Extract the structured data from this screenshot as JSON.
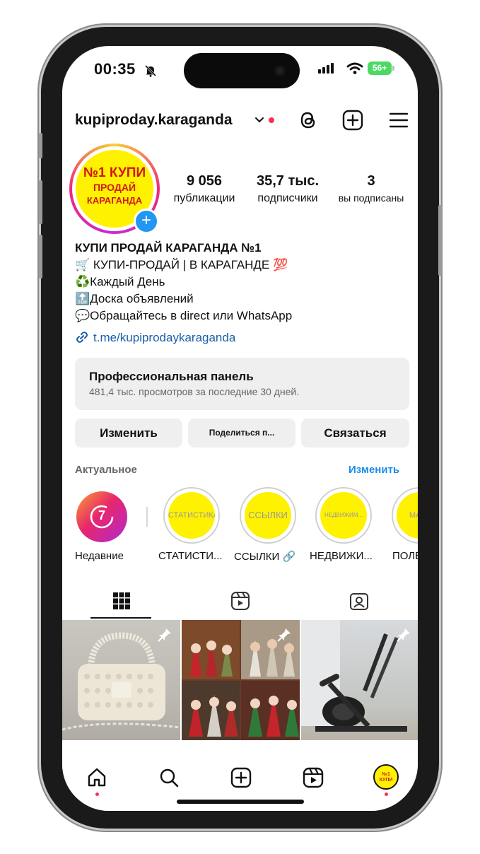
{
  "status": {
    "time": "00:35",
    "battery": "56+"
  },
  "header": {
    "username": "kupiproday.karaganda"
  },
  "profile": {
    "avatar_logo": [
      "№1 КУПИ",
      "ПРОДАЙ",
      "КАРАГАНДА"
    ],
    "stats": [
      {
        "value": "9 056",
        "label": "публикации"
      },
      {
        "value": "35,7 тыс.",
        "label": "подписчики"
      },
      {
        "value": "3",
        "label": "вы подписаны"
      }
    ],
    "name": "КУПИ ПРОДАЙ КАРАГАНДА №1",
    "bio": [
      {
        "emoji": "🛒",
        "text": " КУПИ-ПРОДАЙ | В КАРАГАНДЕ ",
        "suffix": "💯"
      },
      {
        "emoji": "♻️",
        "text": "Каждый День",
        "suffix": ""
      },
      {
        "emoji": "🔝",
        "text": "Доска объявлений",
        "suffix": ""
      },
      {
        "emoji": "💬",
        "text": "Обращайтесь в direct или WhatsApp",
        "suffix": ""
      }
    ],
    "link": "t.me/kupiprodaykaraganda"
  },
  "dashboard": {
    "title": "Профессиональная панель",
    "subtitle": "481,4 тыс. просмотров за последние 30 дней."
  },
  "actions": {
    "edit": "Изменить",
    "share": "Поделиться п...",
    "contact": "Связаться"
  },
  "highlights": {
    "title": "Актуальное",
    "edit": "Изменить",
    "items": [
      {
        "label": "Недавние",
        "cover": "7"
      },
      {
        "label": "СТАТИСТИ...",
        "cover": "СТАТИСТИКА"
      },
      {
        "label": "ССЫЛКИ 🔗",
        "cover": "ССЫЛКИ"
      },
      {
        "label": "НЕДВИЖИ...",
        "cover": "НЕДВИЖИМ..."
      },
      {
        "label": "ПОЛЕ",
        "cover": "МАРК"
      }
    ]
  },
  "colors": {
    "accent": "#1f8ce8",
    "link": "#1a5fa8",
    "notify": "#ff2d55",
    "logo_yellow": "#fff200",
    "logo_red": "#d11818"
  }
}
